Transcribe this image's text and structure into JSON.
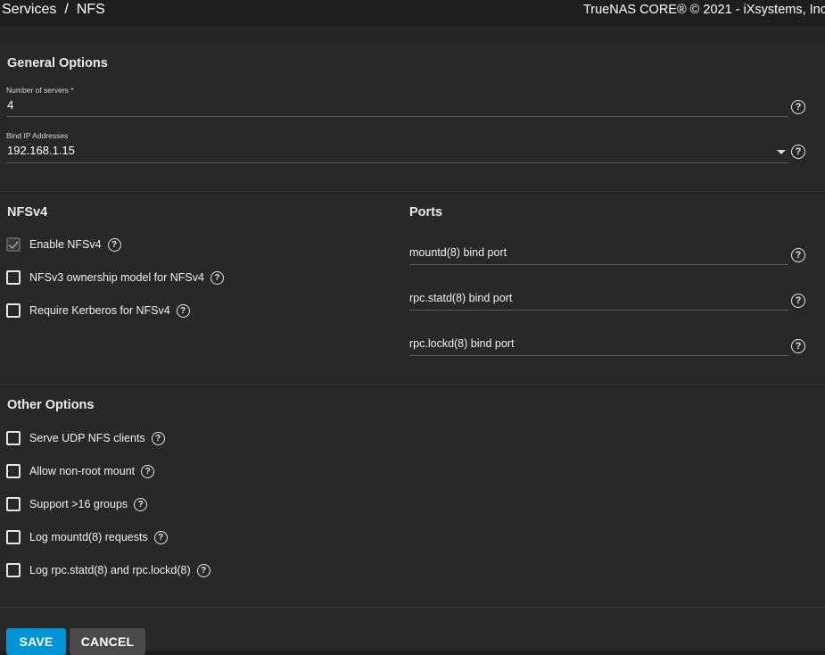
{
  "header": {
    "breadcrumb": [
      "Services",
      "NFS"
    ],
    "breadcrumb_separator": "/",
    "copyright": "TrueNAS CORE® © 2021 - iXsystems, Inc"
  },
  "general": {
    "title": "General Options",
    "servers_label": "Number of servers *",
    "servers_value": "4",
    "bind_ip_label": "Bind IP Addresses",
    "bind_ip_value": "192.168.1.15"
  },
  "nfsv4": {
    "title": "NFSv4",
    "options": [
      {
        "label": "Enable NFSv4",
        "checked": true
      },
      {
        "label": "NFSv3 ownership model for NFSv4",
        "checked": false
      },
      {
        "label": "Require Kerberos for NFSv4",
        "checked": false
      }
    ]
  },
  "ports": {
    "title": "Ports",
    "fields": [
      {
        "label": "mountd(8) bind port",
        "value": ""
      },
      {
        "label": "rpc.statd(8) bind port",
        "value": ""
      },
      {
        "label": "rpc.lockd(8) bind port",
        "value": ""
      }
    ]
  },
  "other": {
    "title": "Other Options",
    "options": [
      {
        "label": "Serve UDP NFS clients",
        "checked": false
      },
      {
        "label": "Allow non-root mount",
        "checked": false
      },
      {
        "label": "Support >16 groups",
        "checked": false
      },
      {
        "label": "Log mountd(8) requests",
        "checked": false
      },
      {
        "label": "Log rpc.statd(8) and rpc.lockd(8)",
        "checked": false
      }
    ]
  },
  "actions": {
    "save_label": "SAVE",
    "cancel_label": "CANCEL"
  },
  "help_glyph": "?",
  "colors": {
    "background": "#1e1e1e",
    "card": "#282828",
    "primary": "#0095d5",
    "secondary_button": "#4a4a4a"
  }
}
